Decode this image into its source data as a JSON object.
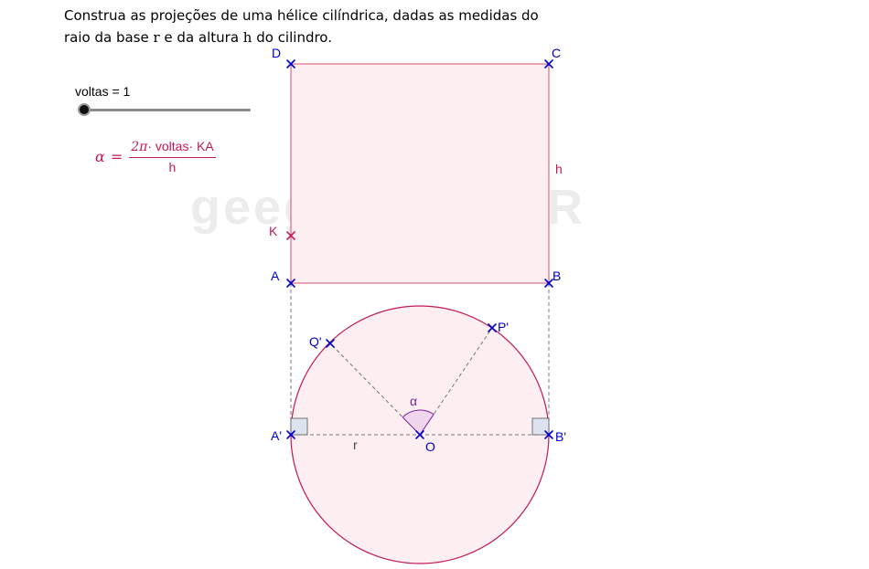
{
  "instruction": {
    "part1": "Construa as projeções de uma hélice cilíndrica, dadas as medidas do",
    "part2": "raio da base ",
    "r": "r",
    "part3": " e da altura ",
    "h": "h",
    "part4": " do cilindro."
  },
  "watermark": "geegraf - UFPR",
  "slider": {
    "label": "voltas = 1",
    "value": 1
  },
  "formula": {
    "lhs": "α",
    "eq": "=",
    "numerator_pi": "2π",
    "numerator_rest": "· voltas· KA",
    "denominator": "h"
  },
  "labels": {
    "D": "D",
    "C": "C",
    "A": "A",
    "B": "B",
    "K": "K",
    "h": "h",
    "Aprime": "A'",
    "Bprime": "B'",
    "O": "O",
    "Pprime": "P'",
    "Qprime": "Q'",
    "r": "r",
    "alpha": "α"
  },
  "colors": {
    "point_blue": "#0000cc",
    "crimson": "#c2185b",
    "fill_pink": "#fdeef1",
    "dashed_gray": "#777777",
    "angle_purple": "#7b1fa2"
  }
}
